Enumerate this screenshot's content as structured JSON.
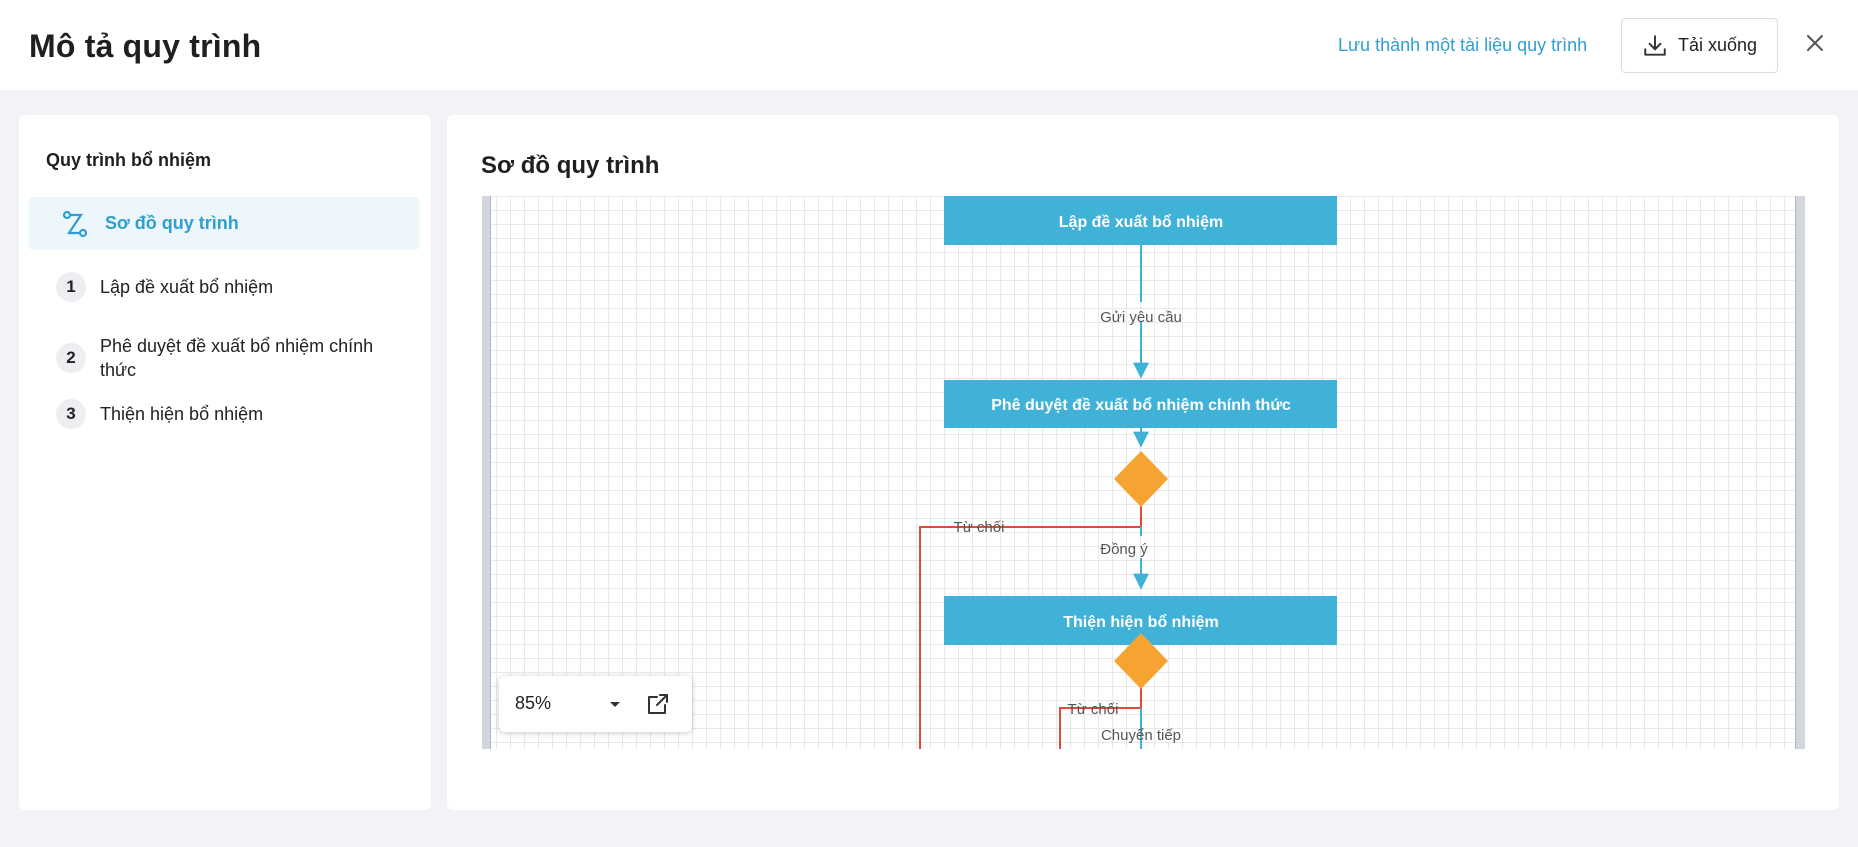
{
  "header": {
    "title": "Mô tả quy trình",
    "save_link": "Lưu thành một tài liệu quy trình",
    "download_label": "Tải xuống"
  },
  "sidebar": {
    "heading": "Quy trình bổ nhiệm",
    "active_item": "Sơ đồ quy trình",
    "steps": [
      {
        "num": "1",
        "label": "Lập đề xuất bổ nhiệm"
      },
      {
        "num": "2",
        "label": "Phê duyệt đề xuất bổ nhiệm chính thức"
      },
      {
        "num": "3",
        "label": "Thiện hiện bổ nhiệm"
      }
    ]
  },
  "main": {
    "title": "Sơ đồ quy trình"
  },
  "diagram": {
    "nodes": [
      "Lập đề xuất bổ nhiệm",
      "Phê duyệt đề xuất bổ nhiệm chính thức",
      "Thiện hiện bổ nhiệm"
    ],
    "edge_labels": {
      "send_request": "Gửi yêu cầu",
      "reject_1": "Từ chối",
      "agree": "Đồng ý",
      "reject_2": "Từ chối",
      "forward": "Chuyển tiếp"
    },
    "colors": {
      "node": "#40b2d8",
      "decision": "#f6a431",
      "arrow": "#40b2d8",
      "reject": "#e04b3b"
    }
  },
  "zoom": {
    "value": "85%"
  }
}
